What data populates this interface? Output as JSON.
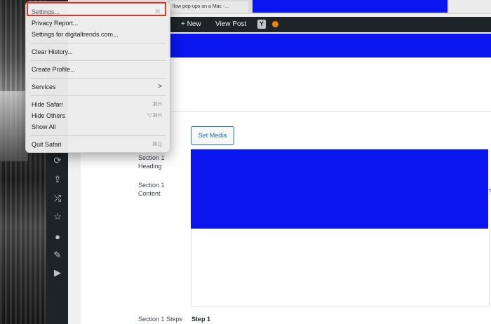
{
  "browser": {
    "tab_title": "llow pop-ups on a Mac -..."
  },
  "admin_bar": {
    "new_label": "+ New",
    "view_post_label": "View Post",
    "yoast_glyph": "Y"
  },
  "editor": {
    "set_media_label": "Set Media",
    "section1_heading_label": "Section 1\nHeading",
    "section1_content_label": "Section 1\nContent",
    "section1_steps_label": "Section 1 Steps",
    "step_value": "Step 1",
    "edge_mark": "?"
  },
  "safari_menu": {
    "items": [
      {
        "label": "Settings...",
        "shortcut": "⌘,"
      },
      {
        "label": "Privacy Report...",
        "shortcut": ""
      },
      {
        "label": "Settings for digitaltrends.com...",
        "shortcut": ""
      },
      {
        "label": "Clear History...",
        "shortcut": ""
      },
      {
        "label": "Create Profile...",
        "shortcut": ""
      },
      {
        "label": "Services",
        "shortcut": ">"
      },
      {
        "label": "Hide Safari",
        "shortcut": "⌘H"
      },
      {
        "label": "Hide Others",
        "shortcut": "⌥⌘H"
      },
      {
        "label": "Show All",
        "shortcut": ""
      },
      {
        "label": "Quit Safari",
        "shortcut": "⌘Q"
      }
    ]
  },
  "sidebar_icons": [
    "refresh-icon",
    "share-icon",
    "shuffle-icon",
    "star-icon",
    "user-icon",
    "wrench-icon",
    "play-icon"
  ],
  "colors": {
    "accent_blue": "#0a15ef",
    "admin_dark": "#1d2327",
    "highlight_red": "#e53225",
    "link_blue": "#2271b1"
  }
}
